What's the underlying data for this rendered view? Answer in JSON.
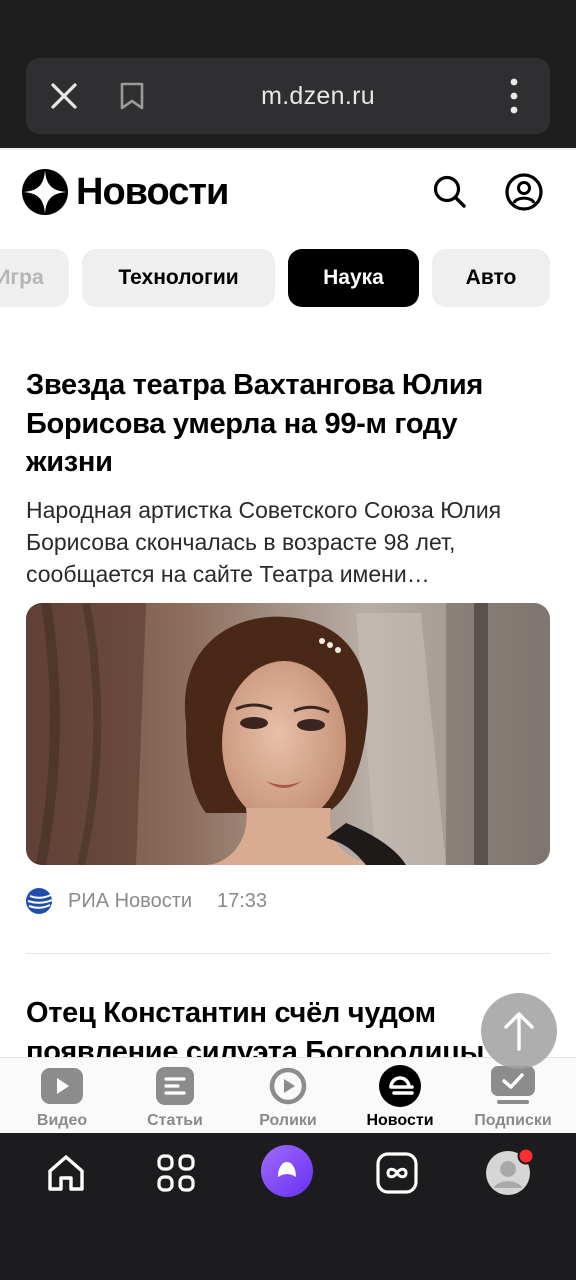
{
  "browser": {
    "url": "m.dzen.ru",
    "icons": [
      "close-icon",
      "bookmark-icon",
      "more-vertical-icon"
    ]
  },
  "header": {
    "logo_text": "Новости",
    "icons": [
      "dzen-logo-icon",
      "search-icon",
      "profile-icon"
    ]
  },
  "categories": {
    "cut_label": "Игра",
    "items": [
      {
        "label": "Технологии",
        "active": false
      },
      {
        "label": "Наука",
        "active": true
      },
      {
        "label": "Авто",
        "active": false
      }
    ]
  },
  "articles": [
    {
      "title": "Звезда театра Вахтангова Юлия Борисова умерла на 99-м году жизни",
      "description": "Народная артистка Советского Союза Юлия Борисова скончалась в возрасте 98 лет, сообщается на сайте Театра имени…",
      "source": "РИА Новости",
      "time": "17:33"
    },
    {
      "title": "Отец Константин счёл чудом появление силуэта Богородицы"
    }
  ],
  "bottom_nav": {
    "items": [
      {
        "label": "Видео",
        "icon": "video-icon",
        "active": false
      },
      {
        "label": "Статьи",
        "icon": "articles-icon",
        "active": false
      },
      {
        "label": "Ролики",
        "icon": "clips-icon",
        "active": false
      },
      {
        "label": "Новости",
        "icon": "news-icon",
        "active": true
      },
      {
        "label": "Подписки",
        "icon": "subscriptions-icon",
        "active": false
      }
    ]
  },
  "system_nav": {
    "icons": [
      "home-icon",
      "apps-icon",
      "alice-icon",
      "infinity-icon",
      "avatar-icon"
    ]
  },
  "colors": {
    "accent_alice": "#7b3ff2",
    "notification": "#ff2d2d",
    "chip_active": "#000000",
    "chip_inactive": "#efefef"
  }
}
